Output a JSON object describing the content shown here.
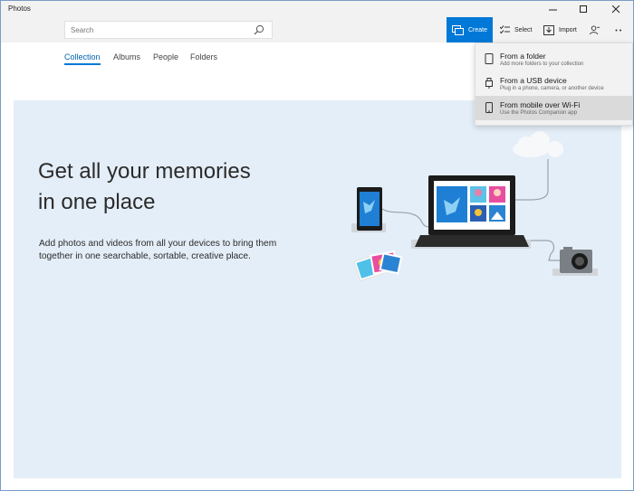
{
  "window": {
    "title": "Photos"
  },
  "search": {
    "placeholder": "Search"
  },
  "toolbar": {
    "create": "Create",
    "select": "Select",
    "import": "Import"
  },
  "nav": {
    "tabs": [
      "Collection",
      "Albums",
      "People",
      "Folders"
    ],
    "active": "Collection"
  },
  "hero": {
    "headline_line1": "Get all your memories",
    "headline_line2": "in one place",
    "description": "Add photos and videos from all your devices to bring them together in one searchable, sortable, creative place."
  },
  "import_menu": {
    "items": [
      {
        "title": "From a folder",
        "subtitle": "Add more folders to your collection",
        "icon": "folder-icon"
      },
      {
        "title": "From a USB device",
        "subtitle": "Plug in a phone, camera, or another device",
        "icon": "usb-icon"
      },
      {
        "title": "From mobile over Wi-Fi",
        "subtitle": "Use the Photos Companion app",
        "icon": "phone-icon"
      }
    ],
    "highlighted": "From mobile over Wi-Fi"
  },
  "colors": {
    "accent": "#0078d7",
    "hero_bg": "#e4eef8",
    "titlebar": "#f2f2f2"
  }
}
